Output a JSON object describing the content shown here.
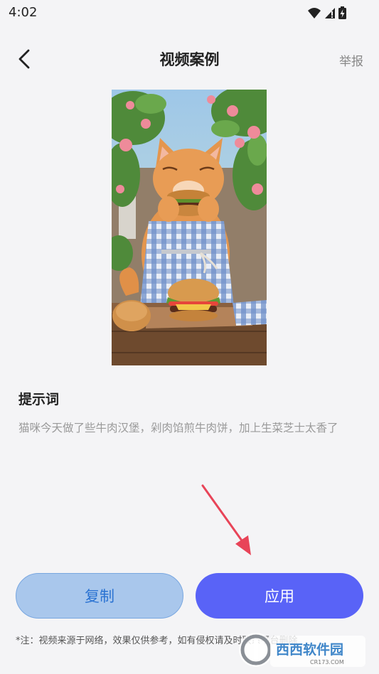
{
  "status_bar": {
    "time": "4:02",
    "icons": [
      "wifi-icon",
      "cell-signal-icon",
      "battery-charging-icon"
    ]
  },
  "header": {
    "back_icon": "chevron-left-icon",
    "title": "视频案例",
    "report_label": "举报"
  },
  "video": {
    "description": "orange tabby cat in blue gingham apron biting a hamburger"
  },
  "prompt": {
    "heading": "提示词",
    "text": "猫咪今天做了些牛肉汉堡，剁肉馅煎牛肉饼，加上生菜芝士太香了"
  },
  "actions": {
    "copy_label": "复制",
    "apply_label": "应用"
  },
  "footnote": "*注：视频来源于网络，效果仅供参考，如有侵权请及时联系平台删除",
  "watermark": {
    "brand": "西西软件园",
    "domain": "CR173.COM"
  },
  "colors": {
    "background": "#f4f4f6",
    "apply_button": "#5963f7",
    "copy_button": "#a9c7ec",
    "copy_text": "#2b73d2",
    "arrow": "#e84458"
  }
}
